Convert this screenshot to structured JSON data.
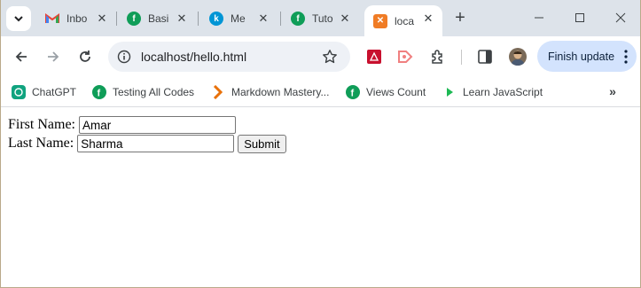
{
  "tabs": [
    {
      "title": "Inbo",
      "favicon": "gmail-icon",
      "color": "#ea4335"
    },
    {
      "title": "Basi",
      "favicon": "f-logo-icon",
      "color": "#0f9d58"
    },
    {
      "title": "Me",
      "favicon": "k-logo-icon",
      "color": "#0095d5"
    },
    {
      "title": "Tuto",
      "favicon": "f-logo-icon",
      "color": "#0f9d58"
    },
    {
      "title": "loca",
      "favicon": "xampp-icon",
      "color": "#f07c25"
    }
  ],
  "address_bar": {
    "url": "localhost/hello.html"
  },
  "toolbar": {
    "finish_update_label": "Finish update"
  },
  "bookmarks": [
    {
      "label": "ChatGPT",
      "icon": "chatgpt-icon",
      "color": "#10a37f"
    },
    {
      "label": "Testing All Codes",
      "icon": "f-logo-icon",
      "color": "#0f9d58"
    },
    {
      "label": "Markdown Mastery...",
      "icon": "markdown-chevron-icon",
      "color": "#e8710a"
    },
    {
      "label": "Views Count",
      "icon": "f-logo-icon",
      "color": "#0f9d58"
    },
    {
      "label": "Learn JavaScript",
      "icon": "play-icon",
      "color": "#1db954"
    }
  ],
  "form": {
    "first_name_label": "First Name:",
    "first_name_value": "Amar",
    "last_name_label": "Last Name:",
    "last_name_value": "Sharma",
    "submit_label": "Submit"
  },
  "colors": {
    "tab_strip": "#dde3ea",
    "omnibox": "#eef1f6",
    "finish_update_bg": "#d3e3fd"
  }
}
